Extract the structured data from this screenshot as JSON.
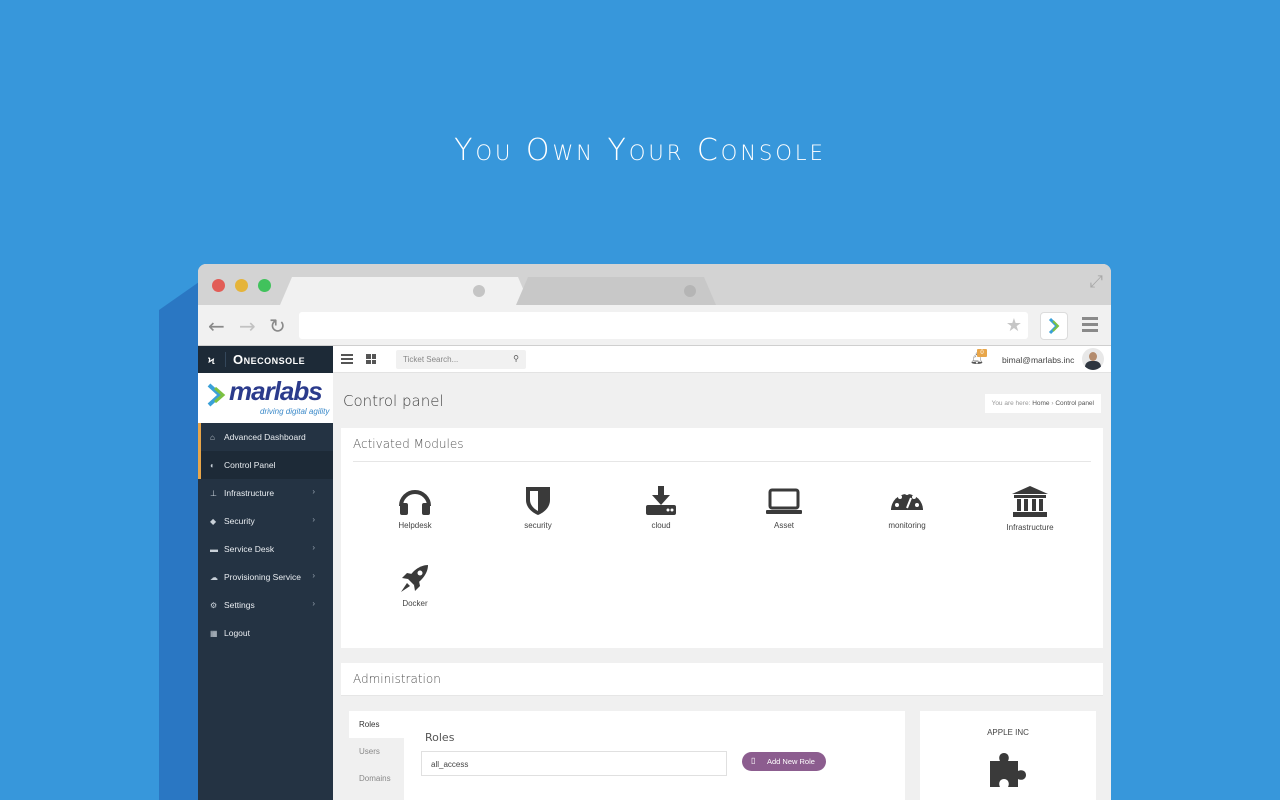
{
  "headline": "You Own Your Console",
  "app": {
    "brand": "Oneconsole",
    "logo_word": "marlabs",
    "logo_tagline": "driving digital agility"
  },
  "sidebar": {
    "items": [
      {
        "label": "Advanced Dashboard",
        "icon": "home-icon",
        "has_children": false
      },
      {
        "label": "Control Panel",
        "icon": "toggle-icon",
        "has_children": false
      },
      {
        "label": "Infrastructure",
        "icon": "sitemap-icon",
        "has_children": true
      },
      {
        "label": "Security",
        "icon": "shield-icon",
        "has_children": true
      },
      {
        "label": "Service Desk",
        "icon": "briefcase-icon",
        "has_children": true
      },
      {
        "label": "Provisioning Service",
        "icon": "cloud-icon",
        "has_children": true
      },
      {
        "label": "Settings",
        "icon": "gears-icon",
        "has_children": true
      },
      {
        "label": "Logout",
        "icon": "calendar-icon",
        "has_children": false
      }
    ]
  },
  "topnav": {
    "search_placeholder": "Ticket Search...",
    "notification_count": "0",
    "user_email": "bimal@marlabs.inc"
  },
  "page": {
    "title": "Control panel",
    "breadcrumb": {
      "prefix": "You are here:",
      "home": "Home",
      "current": "Control panel"
    }
  },
  "activated_modules": {
    "title": "Activated Modules",
    "items": [
      {
        "label": "Helpdesk",
        "icon": "headphones-icon"
      },
      {
        "label": "security",
        "icon": "shield-icon"
      },
      {
        "label": "cloud",
        "icon": "download-icon"
      },
      {
        "label": "Asset",
        "icon": "laptop-icon"
      },
      {
        "label": "monitoring",
        "icon": "dashboard-icon"
      },
      {
        "label": "Infrastructure",
        "icon": "institution-icon"
      },
      {
        "label": "Docker",
        "icon": "rocket-icon"
      }
    ]
  },
  "administration": {
    "title": "Administration",
    "tabs": [
      "Roles",
      "Users",
      "Domains"
    ],
    "roles": {
      "heading": "Roles",
      "input_value": "all_access",
      "add_button": "Add New Role"
    },
    "org": {
      "name": "APPLE INC",
      "icon": "puzzle-icon"
    }
  },
  "colors": {
    "background": "#3797db",
    "sidebar": "#243343",
    "accent": "#e8a64a",
    "button": "#8c5d8f"
  }
}
